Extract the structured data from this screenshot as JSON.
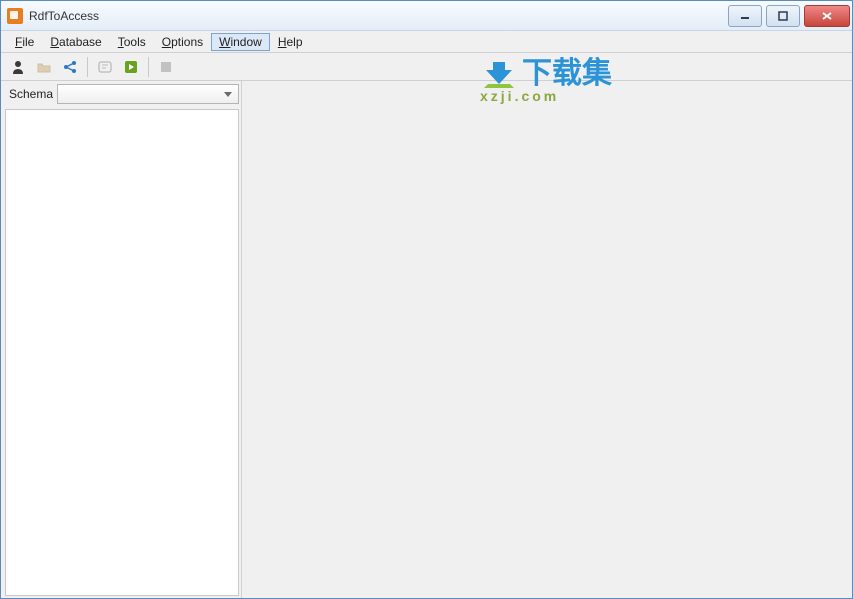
{
  "window": {
    "title": "RdfToAccess"
  },
  "menu": {
    "file": "File",
    "database": "Database",
    "tools": "Tools",
    "options": "Options",
    "window": "Window",
    "help": "Help"
  },
  "sidebar": {
    "schema_label": "Schema"
  },
  "watermark": {
    "main": "下载集",
    "sub": "xzji.com"
  }
}
